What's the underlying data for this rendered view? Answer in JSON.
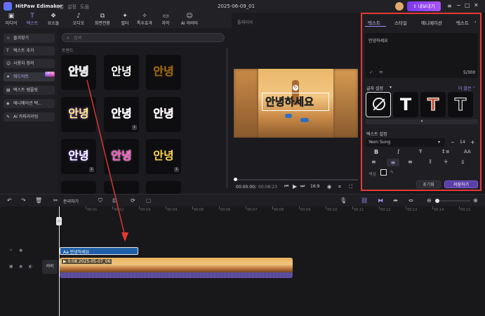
{
  "app": {
    "title": "HitPaw Edimakor",
    "menu": [
      "파일",
      "설정",
      "도움"
    ],
    "project_name": "2025-06-09_01",
    "export_label": "내보내기",
    "window_controls": [
      "menu-icon",
      "minimize-icon",
      "maximize-icon",
      "close-icon"
    ]
  },
  "topnav": {
    "items": [
      {
        "label": "미디어",
        "icon": "media-icon"
      },
      {
        "label": "텍스트",
        "icon": "text-icon"
      },
      {
        "label": "요소들",
        "icon": "elements-icon"
      },
      {
        "label": "오디오",
        "icon": "audio-icon"
      },
      {
        "label": "화면전환",
        "icon": "transition-icon"
      },
      {
        "label": "필터",
        "icon": "filter-icon"
      },
      {
        "label": "특수효과",
        "icon": "effects-icon"
      },
      {
        "label": "자막",
        "icon": "subtitle-icon"
      },
      {
        "label": "AI 아바타",
        "icon": "avatar-icon"
      }
    ],
    "active_index": 1
  },
  "sidebar": {
    "items": [
      {
        "label": "즐겨찾기",
        "icon": "star-icon"
      },
      {
        "label": "텍스트 추가",
        "icon": "text-add-icon"
      },
      {
        "label": "사용자 정의",
        "icon": "user-icon"
      },
      {
        "label": "워드아트",
        "icon": "wordart-icon"
      },
      {
        "label": "텍스트 템플릿",
        "icon": "template-icon"
      },
      {
        "label": "애니메이션 텍...",
        "icon": "animation-icon"
      },
      {
        "label": "AI 카피라이팅",
        "icon": "ai-icon"
      }
    ],
    "active_index": 3,
    "new_badge": "NEW"
  },
  "library": {
    "search_placeholder": "검색",
    "section_title": "트렌드",
    "tile_text": "안녕"
  },
  "player": {
    "label": "플레이어",
    "overlay_text": "안녕하세요",
    "current_time": "00:00:00",
    "total_time": "00:08:23",
    "aspect_ratio": "16:9"
  },
  "panel": {
    "tabs": [
      "텍스트",
      "스타일",
      "애니메이션",
      "텍스트"
    ],
    "active_tab": 0,
    "text_value": "안녕하세요",
    "char_count": "5/300",
    "glyph_section": "글자 설정",
    "more_label": "더 많은",
    "text_settings": "텍스트 설정",
    "font": "Yeon Sung",
    "font_size": "14",
    "color_label": "색상",
    "reset_label": "초기화",
    "save_label": "저장하기"
  },
  "toolbar": {
    "split_label": "분리하기"
  },
  "timeline": {
    "ruler": [
      "00:00",
      "00:01",
      "00:02",
      "00:03",
      "00:04",
      "00:05",
      "00:06",
      "00:07",
      "00:08",
      "00:09",
      "00:10",
      "00:11",
      "00:12",
      "00:13",
      "00:14",
      "00:15",
      "00:16",
      "00:17"
    ],
    "text_clip": "Aa 안녕하세요",
    "video_clip": "0:08 2025-05-07_06",
    "cover_label": "커버"
  },
  "colors": {
    "accent": "#8b5cf6",
    "highlight": "#e53935",
    "text_clip": "#1f5fa8"
  }
}
